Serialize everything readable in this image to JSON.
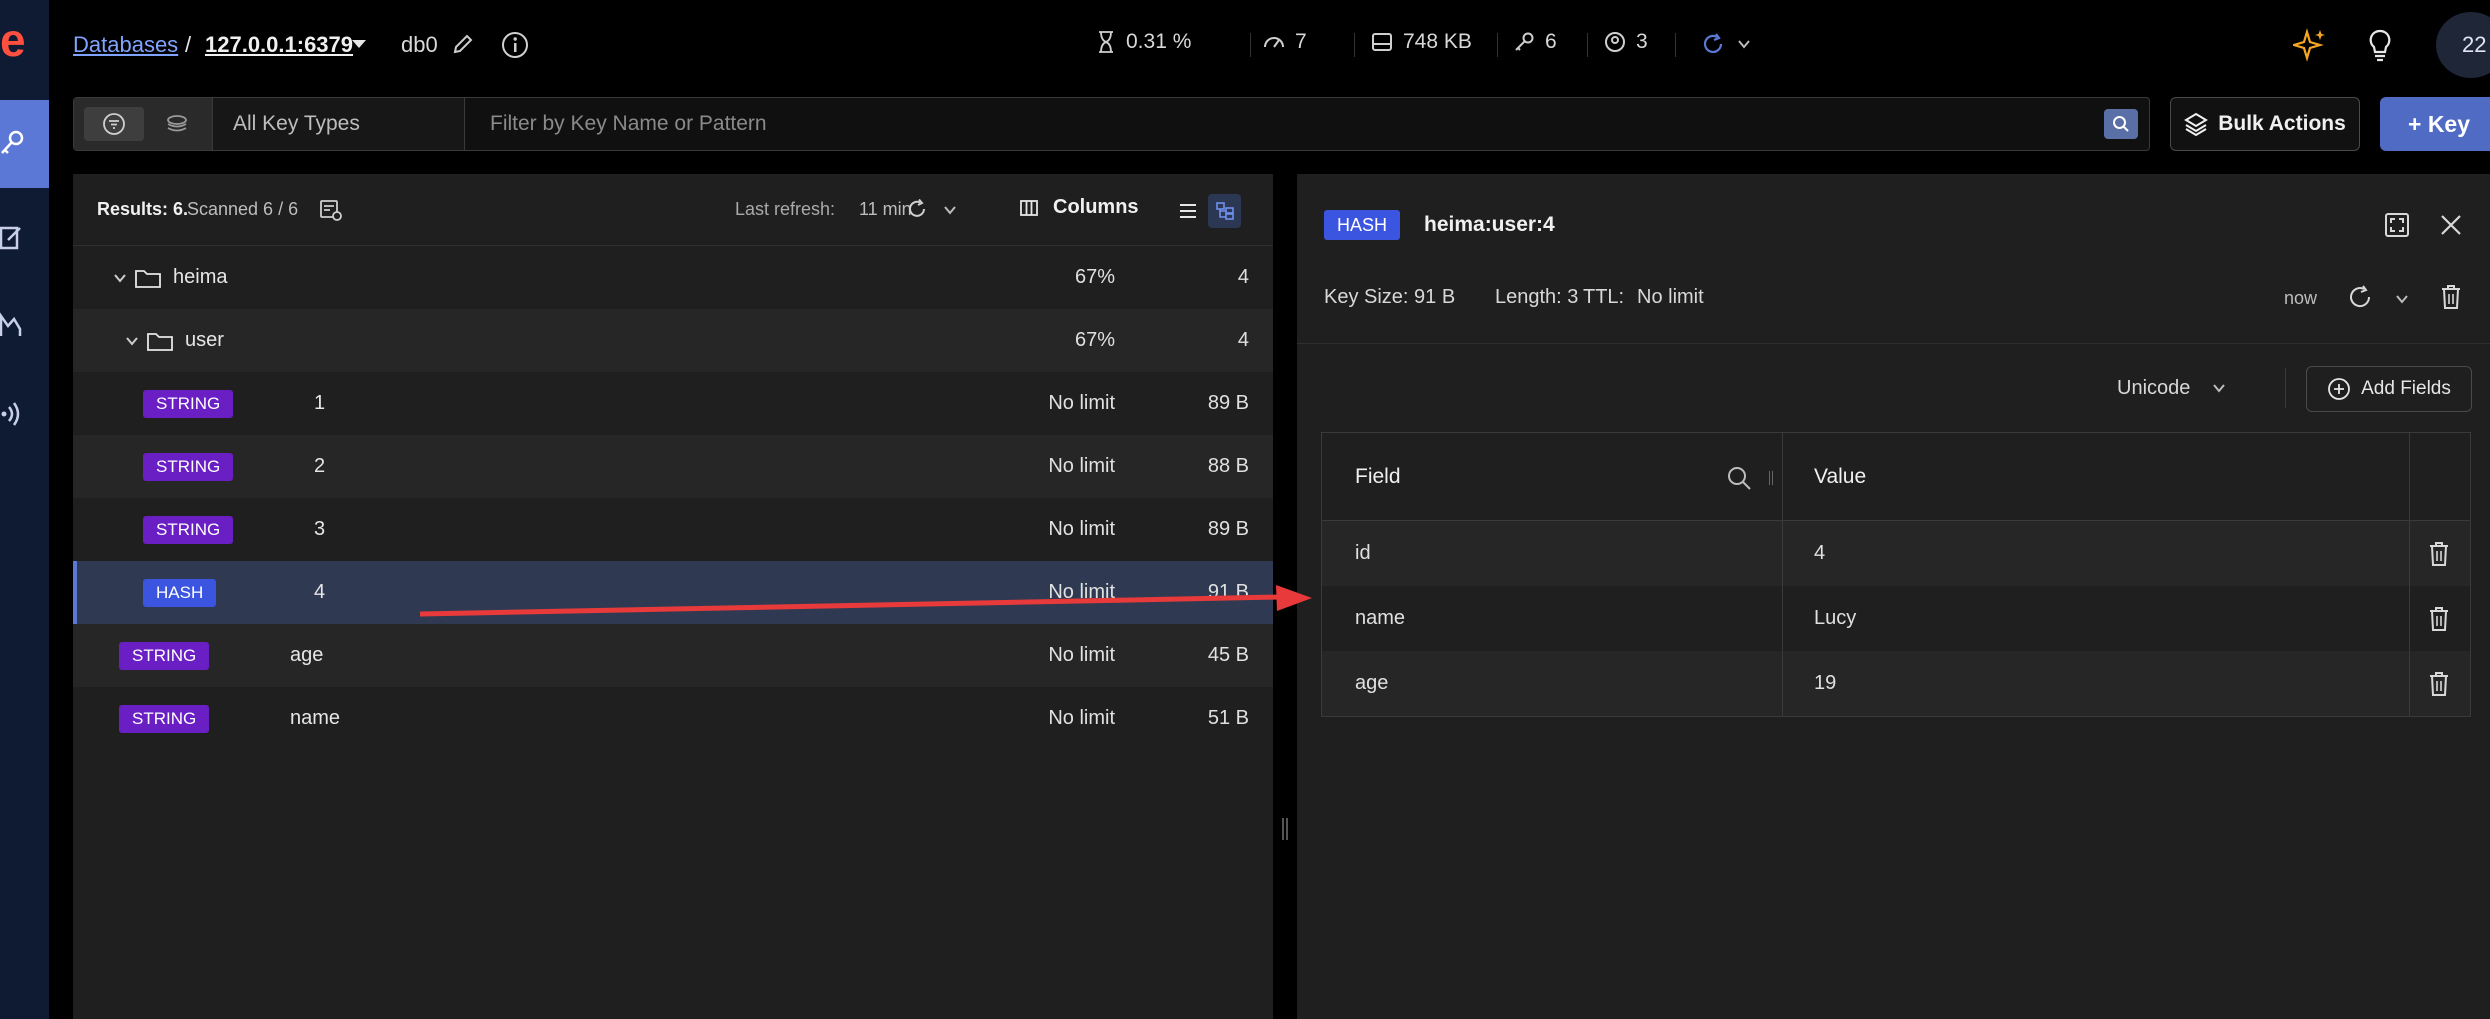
{
  "header": {
    "breadcrumb_databases": "Databases",
    "breadcrumb_sep": "/",
    "breadcrumb_host": "127.0.0.1:6379",
    "db_name": "db0",
    "metrics": {
      "cpu": "0.31 %",
      "ops": "7",
      "memory": "748 KB",
      "keys": "6",
      "clients": "3"
    },
    "avatar_initials": "22"
  },
  "filter": {
    "key_type": "All Key Types",
    "placeholder": "Filter by Key Name or Pattern",
    "bulk_actions": "Bulk Actions",
    "add_key": "+ Key"
  },
  "list": {
    "results_label": "Results: 6.",
    "scanned_label": "Scanned 6 / 6",
    "last_refresh_label": "Last refresh:",
    "last_refresh_value": "11 min",
    "columns_label": "Columns",
    "folders": [
      {
        "name": "heima",
        "percent": "67%",
        "count": "4"
      },
      {
        "name": "user",
        "percent": "67%",
        "count": "4"
      }
    ],
    "keys": [
      {
        "type": "STRING",
        "name": "1",
        "ttl": "No limit",
        "size": "89 B"
      },
      {
        "type": "STRING",
        "name": "2",
        "ttl": "No limit",
        "size": "88 B"
      },
      {
        "type": "STRING",
        "name": "3",
        "ttl": "No limit",
        "size": "89 B"
      },
      {
        "type": "HASH",
        "name": "4",
        "ttl": "No limit",
        "size": "91 B"
      },
      {
        "type": "STRING",
        "name": "age",
        "ttl": "No limit",
        "size": "45 B"
      },
      {
        "type": "STRING",
        "name": "name",
        "ttl": "No limit",
        "size": "51 B"
      }
    ]
  },
  "detail": {
    "type": "HASH",
    "key_name": "heima:user:4",
    "key_size": "Key Size: 91 B",
    "length": "Length: 3",
    "ttl_label": "TTL:",
    "ttl_value": "No limit",
    "refreshed": "now",
    "format": "Unicode",
    "add_fields": "Add Fields",
    "columns": {
      "field": "Field",
      "value": "Value"
    },
    "rows": [
      {
        "field": "id",
        "value": "4"
      },
      {
        "field": "name",
        "value": "Lucy"
      },
      {
        "field": "age",
        "value": "19"
      }
    ]
  },
  "colors": {
    "string_badge": "#6a1fc4",
    "hash_badge": "#3b55e0",
    "accent": "#5b78d6",
    "annotation_arrow": "#e83a3a"
  }
}
